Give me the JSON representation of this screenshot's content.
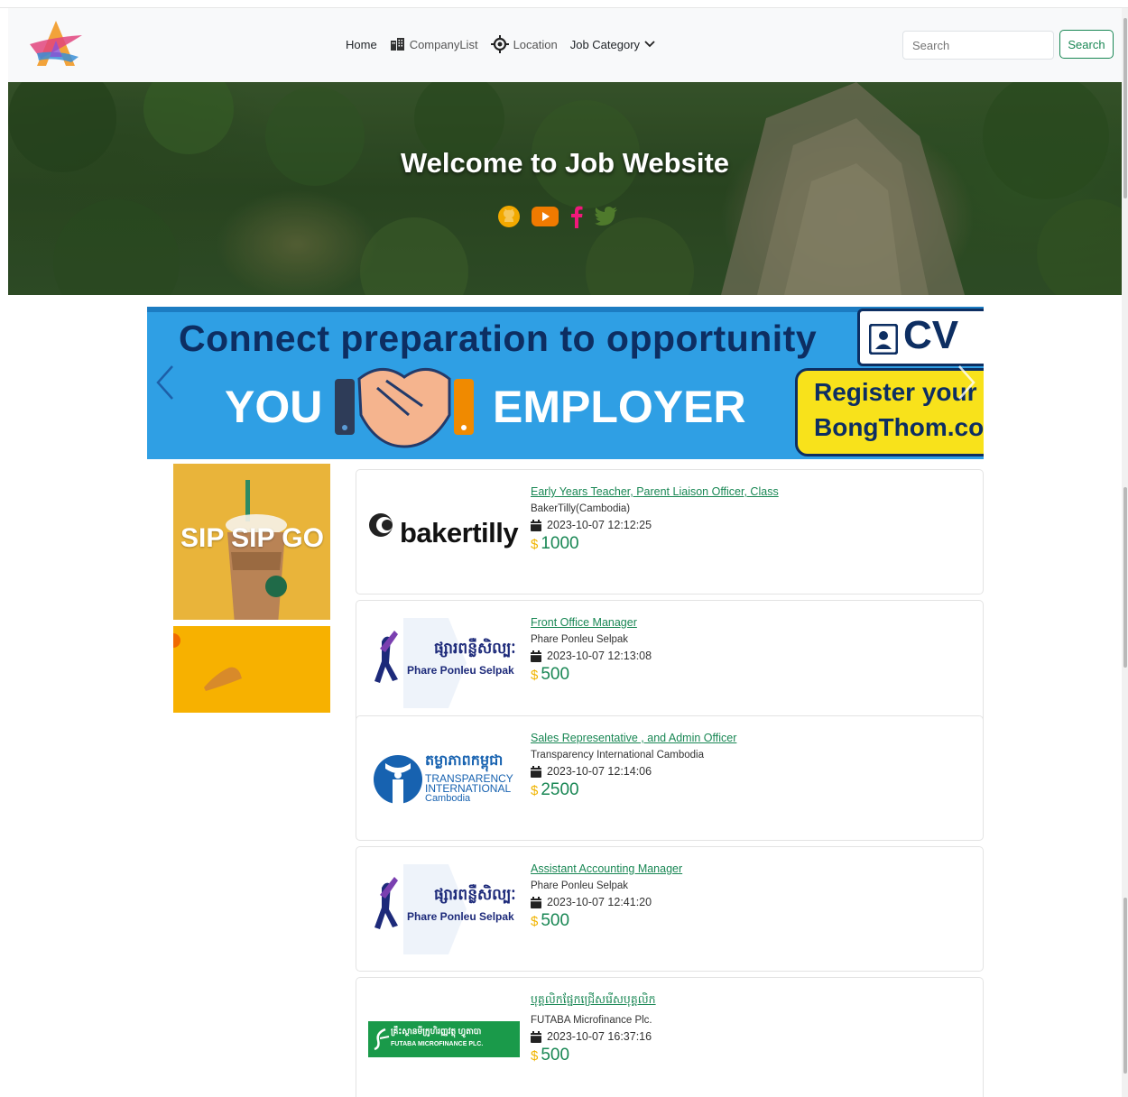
{
  "navbar": {
    "home": "Home",
    "company_list": "CompanyList",
    "location": "Location",
    "job_category": "Job Category",
    "search_placeholder": "Search",
    "search_button": "Search"
  },
  "hero": {
    "title": "Welcome to Job Website",
    "social_icons": [
      "github-icon",
      "youtube-icon",
      "facebook-icon",
      "twitter-icon"
    ]
  },
  "banner": {
    "headline": "Connect preparation to opportunity",
    "left_word": "YOU",
    "right_word": "EMPLOYER",
    "cv_label": "CV",
    "register_line1": "Register your",
    "register_line2": "BongThom.com"
  },
  "ads": {
    "ad1_text": "SIP SIP GO"
  },
  "jobs": [
    {
      "title": "Early Years Teacher, Parent Liaison Officer, Class",
      "company": "BakerTilly(Cambodia)",
      "date": "2023-10-07 12:12:25",
      "currency": "$",
      "salary": "1000",
      "logo_text": "bakertilly"
    },
    {
      "title": "Front Office Manager",
      "company": "Phare Ponleu Selpak",
      "date": "2023-10-07 12:13:08",
      "currency": "$",
      "salary": "500",
      "logo_text": "Phare Ponleu Selpak",
      "logo_khmer": "ផ្សារពន្លឺសិល្បៈ"
    },
    {
      "title": "Sales Representative , and Admin Officer",
      "company": "Transparency International Cambodia",
      "date": "2023-10-07 12:14:06",
      "currency": "$",
      "salary": "2500",
      "logo_khmer": "តម្លាភាពកម្ពុជា",
      "logo_line1": "TRANSPARENCY",
      "logo_line2": "INTERNATIONAL",
      "logo_line3": "Cambodia"
    },
    {
      "title": "Assistant Accounting Manager",
      "company": "Phare Ponleu Selpak",
      "date": "2023-10-07 12:41:20",
      "currency": "$",
      "salary": "500",
      "logo_text": "Phare Ponleu Selpak",
      "logo_khmer": "ផ្សារពន្លឺសិល្បៈ"
    },
    {
      "title": "បុគ្គលិកផ្នែកជ្រើសរើសបុគ្គលិក",
      "company": "FUTABA Microfinance Plc.",
      "date": "2023-10-07 16:37:16",
      "currency": "$",
      "salary": "500",
      "logo_text": "FUTABA MICROFINANCE PLC.",
      "logo_khmer": "គ្រឹះស្ថានមីក្រូហិរញ្ញវត្ថុ ហ្វូតាបា"
    }
  ],
  "colors": {
    "accent_green": "#198754",
    "dollar_yellow": "#f0b400",
    "banner_blue": "#2f9fe4",
    "banner_navy": "#0d2e62"
  }
}
